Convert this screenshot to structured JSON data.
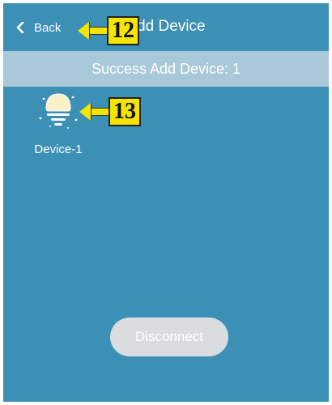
{
  "header": {
    "back_label": "Back",
    "title": "Add Device"
  },
  "banner": {
    "text": "Success Add Device: 1"
  },
  "devices": [
    {
      "label": "Device-1",
      "icon": "bulb-icon"
    }
  ],
  "actions": {
    "disconnect_label": "Disconnect"
  },
  "annotations": [
    {
      "number": "12"
    },
    {
      "number": "13"
    }
  ],
  "colors": {
    "background": "#3c8fb5",
    "banner": "#a9c8d8",
    "button": "#d9dde0",
    "callout": "#f4e400"
  }
}
